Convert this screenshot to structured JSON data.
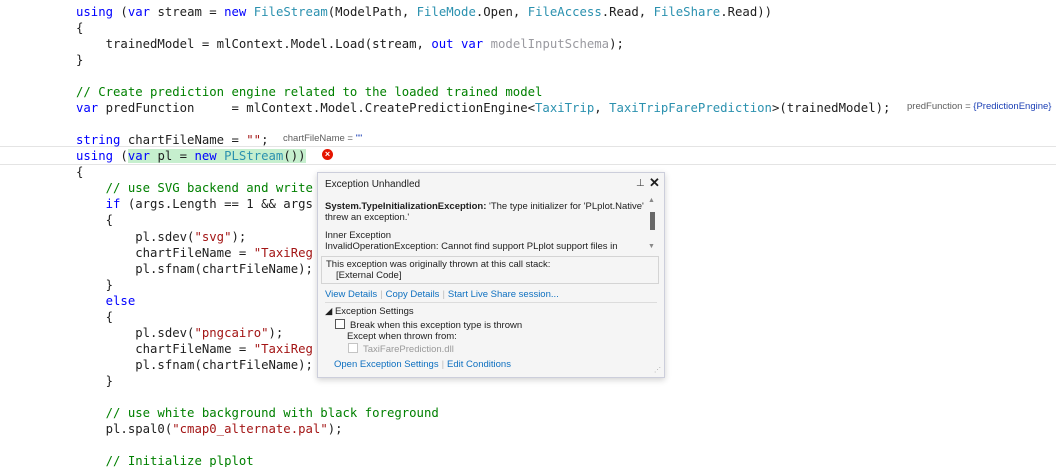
{
  "code": {
    "l1": {
      "a": "using",
      "b": " (",
      "c": "var",
      "d": " stream = ",
      "e": "new",
      "f": " ",
      "g": "FileStream",
      "h": "(ModelPath, ",
      "i": "FileMode",
      "j": ".Open, ",
      "k": "FileAccess",
      "l": ".Read, ",
      "m": "FileShare",
      "n": ".Read))"
    },
    "l2": "{",
    "l3": {
      "a": "    trainedModel = mlContext.Model.Load(stream, ",
      "b": "out",
      "c": " ",
      "d": "var",
      "e": " ",
      "f": "modelInputSchema",
      "g": ");"
    },
    "l4": "}",
    "l5": "// Create prediction engine related to the loaded trained model",
    "l6": {
      "a": "var",
      "b": " predFunction     = mlContext.Model.CreatePredictionEngine<",
      "c": "TaxiTrip",
      "d": ", ",
      "e": "TaxiTripFarePrediction",
      "f": ">(trainedModel);"
    },
    "l7": {
      "a": "string",
      "b": " chartFileName = ",
      "c": "\"\"",
      "d": ";"
    },
    "l8": {
      "a": "using",
      "b": " (",
      "c": "var",
      "d": " pl = ",
      "e": "new",
      "f": " ",
      "g": "PLStream",
      "h": "())"
    },
    "l9": "{",
    "l10": "    // use SVG backend and write",
    "l11": {
      "a": "    ",
      "b": "if",
      "c": " (args.Length == 1 && args"
    },
    "l12": "    {",
    "l13": {
      "a": "        pl.sdev(",
      "b": "\"svg\"",
      "c": ");"
    },
    "l14": {
      "a": "        chartFileName = ",
      "b": "\"TaxiReg"
    },
    "l15": "        pl.sfnam(chartFileName);",
    "l16": "    }",
    "l17": {
      "a": "    ",
      "b": "else"
    },
    "l18": "    {",
    "l19": {
      "a": "        pl.sdev(",
      "b": "\"pngcairo\"",
      "c": ");"
    },
    "l20": {
      "a": "        chartFileName = ",
      "b": "\"TaxiReg"
    },
    "l21": "        pl.sfnam(chartFileName);",
    "l22": "    }",
    "l23": "    // use white background with black foreground",
    "l24": {
      "a": "    pl.spal0(",
      "b": "\"cmap0_alternate.pal\"",
      "c": ");"
    },
    "l25": "    // Initialize plplot"
  },
  "hints": {
    "pred": {
      "label": "predFunction = ",
      "value": "{PredictionEngine}"
    },
    "chart": {
      "label": "chartFileName = ",
      "value": "\"\""
    }
  },
  "error_glyph": "×",
  "popup": {
    "title": "Exception Unhandled",
    "pin": "⊥",
    "close": "✕",
    "exception_type": "System.TypeInitializationException:",
    "exception_msg": " 'The type initializer for 'PLplot.Native' threw an exception.'",
    "inner_header": "Inner Exception",
    "inner_text": "InvalidOperationException: Cannot find support PLplot support files in",
    "stack_line1": "This exception was originally thrown at this call stack:",
    "stack_line2": "[External Code]",
    "links": {
      "view_details": "View Details",
      "copy_details": "Copy Details",
      "live_share": "Start Live Share session..."
    },
    "settings_header": "◢ Exception Settings",
    "break_label": "Break when this exception type is thrown",
    "except_label": "Except when thrown from:",
    "dll_label": "TaxiFarePrediction.dll",
    "links2": {
      "open_settings": "Open Exception Settings",
      "edit_conditions": "Edit Conditions"
    },
    "separator": "|",
    "scroll_up": "▲",
    "scroll_down": "▼",
    "grip": "⋰"
  }
}
